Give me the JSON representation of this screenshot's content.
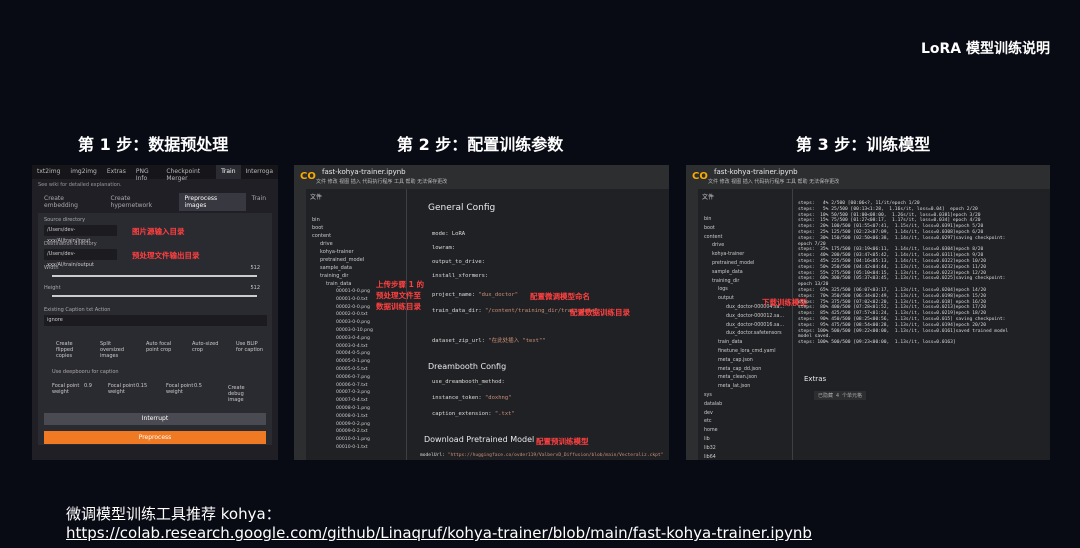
{
  "header": {
    "title": "LoRA 模型训练说明"
  },
  "steps": [
    {
      "label": "第 1 步：数据预处理"
    },
    {
      "label": "第 2 步：配置训练参数"
    },
    {
      "label": "第 3 步：训练模型"
    }
  ],
  "shot1": {
    "tabs": [
      "txt2img",
      "img2img",
      "Extras",
      "PNG Info",
      "Checkpoint Merger",
      "Train",
      "Interroga"
    ],
    "note": "See wiki for detailed explanation.",
    "subtabs": [
      "Create embedding",
      "Create hypernetwork",
      "Preprocess images",
      "Train"
    ],
    "source_label": "Source directory",
    "source_value": "/Users/dev-xxx/AI/train/input",
    "dest_label": "Destination directory",
    "dest_value": "/Users/dev-xxx/AI/train/output",
    "width_label": "Width",
    "width_value": "512",
    "height_label": "Height",
    "height_value": "512",
    "caption_label": "Existing Caption txt Action",
    "caption_value": "ignore",
    "checks": [
      "Create flipped copies",
      "Split oversized images",
      "Auto focal point crop",
      "Auto-sized crop",
      "Use BLIP for caption"
    ],
    "deepbooru": "Use deepbooru for caption",
    "weights": [
      {
        "label": "Focal point weight",
        "value": "0.9"
      },
      {
        "label": "Focal point weight",
        "value": "0.15"
      },
      {
        "label": "Focal point weight",
        "value": "0.5"
      }
    ],
    "debug": "Create debug image",
    "interrupt": "Interrupt",
    "preprocess": "Preprocess",
    "ann_input": "图片源输入目录",
    "ann_output": "预处理文件输出目录"
  },
  "shot2": {
    "logo": "CO",
    "notebook": "fast-kohya-trainer.ipynb",
    "menu": "文件 修改 视图 插入 代码执行程序 工具 帮助 无法保存更改",
    "files_title": "文件",
    "tree": [
      "bin",
      "boot",
      "content",
      "drive",
      "kohya-trainer",
      "pretrained_model",
      "sample_data",
      "training_dir",
      "train_data"
    ],
    "files": [
      "00001-0-0.png",
      "00001-0-0.txt",
      "00002-0-0.png",
      "00002-0-0.txt",
      "00003-0-0.png",
      "00003-0-10.png",
      "00003-0-4.png",
      "00003-0-4.txt",
      "00004-0-5.png",
      "00005-0-1.png",
      "00005-0-5.txt",
      "00006-0-7.png",
      "00006-0-7.txt",
      "00007-0-3.png",
      "00007-0-4.txt",
      "00008-0-1.png",
      "00008-0-1.txt",
      "00009-0-2.png",
      "00009-0-2.txt",
      "00010-0-1.png",
      "00010-0-1.txt"
    ],
    "ann_files": "上传步骤 1 的\n预处理文件至\n数据训练目录",
    "general": "General Config",
    "mode": "mode:",
    "mode_val": "LoRA",
    "lowram": "lowram:",
    "output_drive": "output_to_drive:",
    "install_xformers": "install_xformers:",
    "project_name": "project_name:",
    "project_val": "\"dux_doctor\"",
    "ann_project": "配置微调模型命名",
    "train_data_dir": "train_data_dir:",
    "train_data_val": "\"/content/training_dir/train_data\"",
    "ann_train": "配置数据训练目录",
    "dataset_zip": "dataset_zip_url:",
    "dataset_val": "\"在此处插入 \"text\"\"",
    "dreambooth": "Dreambooth Config",
    "use_dreambooth": "use_dreambooth_method:",
    "instance_token": "instance_token:",
    "instance_val": "\"doxhng\"",
    "caption_ext": "caption_extension:",
    "caption_val": "\".txt\"",
    "download": "Download Pretrained Model",
    "ann_model": "配置预训练模型",
    "model_url": "modelUrl:",
    "model_val": "\"https://huggingface.co/ovder119/ValbervD_Diffusion/blob/main/Vecteraliz.ckpt\""
  },
  "shot3": {
    "logo": "CO",
    "notebook": "fast-kohya-trainer.ipynb",
    "menu": "文件 修改 视图 插入 代码执行程序 工具 帮助 无法保存更改",
    "files_title": "文件",
    "tree": [
      "bin",
      "boot",
      "content",
      "drive",
      "kohya-trainer",
      "pretrained_model",
      "sample_data",
      "training_dir",
      "logs",
      "output",
      "dux_doctor-000004.sa...",
      "dux_doctor-000012.sa...",
      "dux_doctor-000016.sa...",
      "dux_doctor.safetensors",
      "train_data",
      "finetune_lora_cmd.yaml",
      "meta_cap.json",
      "meta_cap_dd.json",
      "meta_clean.json",
      "meta_lat.json",
      "sys",
      "datalab",
      "dev",
      "etc",
      "home",
      "lib",
      "lib32",
      "lib64"
    ],
    "ann_output": "下载训练模型",
    "log": "steps:   4% 2/500 [00:06<?, 11/it/epoch 1/20\nsteps:   5% 25/500 [00:13<1:28,  1.16s/it, loss=0.04]  epoch 2/20\nsteps:  10% 50/500 [01:00<08:00,  1.26s/it, loss=0.0381]epoch 3/20\nsteps:  15% 75/500 [01:27<08:17,  1.17s/it, loss=0.034] epoch 4/20\nsteps:  20% 100/500 [01:55<07:41,  1.15s/it, loss=0.0391]epoch 5/20\nsteps:  25% 125/500 [02:23<07:09,  1.14s/it, loss=0.0308]epoch 6/20\nsteps:  30% 150/500 [02:50<06:38,  1.14s/it, loss=0.0297]saving checkpoint:\nepoch 7/20\nsteps:  35% 175/500 [03:19<06:11,  1.14s/it, loss=0.0304]epoch 8/20\nsteps:  40% 200/500 [03:47<05:42,  1.14s/it, loss=0.0311]epoch 9/20\nsteps:  45% 225/500 [04:16<05:13,  1.14s/it, loss=0.0322]epoch 10/20\nsteps:  50% 250/500 [04:42<04:44,  1.13s/it, loss=0.0232]epoch 11/20\nsteps:  55% 275/500 [05:10<04:15,  1.13s/it, loss=0.0223]epoch 12/20\nsteps:  60% 300/500 [05:37<03:45,  1.13s/it, loss=0.0225]saving checkpoint:\nepoch 13/20\nsteps:  65% 325/500 [06:07<03:17,  1.13s/it, loss=0.0204]epoch 14/20\nsteps:  70% 350/500 [06:34<02:49,  1.13s/it, loss=0.0198]epoch 15/20\nsteps:  75% 375/500 [07:02<02:20,  1.13s/it, loss=0.018] epoch 16/20\nsteps:  80% 400/500 [07:28<01:52,  1.13s/it, loss=0.0213]epoch 17/20\nsteps:  85% 425/500 [07:57<01:24,  1.13s/it, loss=0.0219]epoch 18/20\nsteps:  90% 450/500 [08:25<00:56,  1.13s/it, loss=0.015] saving checkpoint:\nsteps:  95% 475/500 [08:54<00:28,  1.13s/it, loss=0.0194]epoch 20/20\nsteps: 100% 500/500 [09:22<00:00,  1.13s/it, loss=0.0161]saved trained model\nmodel saved.\nsteps: 100% 500/500 [09:23<00:00,  1.13s/it, loss=0.0163]",
    "extras": "Extras",
    "hidden": "已隐藏 4 个单元格"
  },
  "footer": {
    "line1": "微调模型训练工具推荐 kohya：",
    "url": "https://colab.research.google.com/github/Linaqruf/kohya-trainer/blob/main/fast-kohya-trainer.ipynb"
  }
}
